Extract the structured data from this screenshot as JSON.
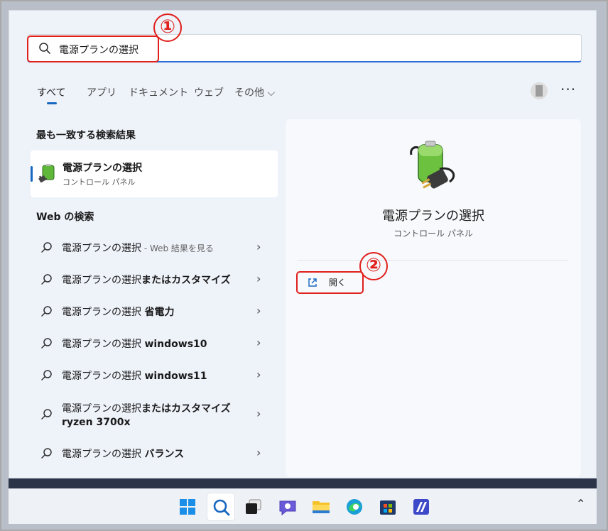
{
  "search": {
    "query": "電源プランの選択"
  },
  "tabs": [
    {
      "label": "すべて"
    },
    {
      "label": "アプリ"
    },
    {
      "label": "ドキュメント"
    },
    {
      "label": "ウェブ"
    },
    {
      "label": "その他 ⌵"
    }
  ],
  "header": {
    "more_label": "···"
  },
  "best_match": {
    "heading": "最も一致する検索結果",
    "title": "電源プランの選択",
    "subtitle": "コントロール パネル"
  },
  "web_search": {
    "heading": "Web の検索",
    "items": [
      {
        "text": "電源プランの選択",
        "bold": "",
        "suffix": " - Web 結果を見る"
      },
      {
        "text": "電源プランの選択",
        "bold": "またはカスタマイズ",
        "suffix": ""
      },
      {
        "text": "電源プランの選択 ",
        "bold": "省電力",
        "suffix": ""
      },
      {
        "text": "電源プランの選択 ",
        "bold": "windows10",
        "suffix": ""
      },
      {
        "text": "電源プランの選択 ",
        "bold": "windows11",
        "suffix": ""
      },
      {
        "text": "電源プランの選択",
        "bold": "またはカスタマイズ",
        "suffix": "",
        "line2": "ryzen 3700x"
      },
      {
        "text": "電源プランの選択 ",
        "bold": "バランス",
        "suffix": ""
      }
    ]
  },
  "detail": {
    "title": "電源プランの選択",
    "subtitle": "コントロール パネル",
    "open_label": "開く"
  },
  "annotations": {
    "one": "①",
    "two": "②"
  },
  "taskbar": {
    "icons": [
      "windows-start-icon",
      "search-icon",
      "task-view-icon",
      "chat-icon",
      "file-explorer-icon",
      "edge-icon",
      "store-icon",
      "app-icon"
    ],
    "tray_chevron": "^"
  },
  "colors": {
    "accent": "#1867c0",
    "annotation": "#e0201c"
  }
}
